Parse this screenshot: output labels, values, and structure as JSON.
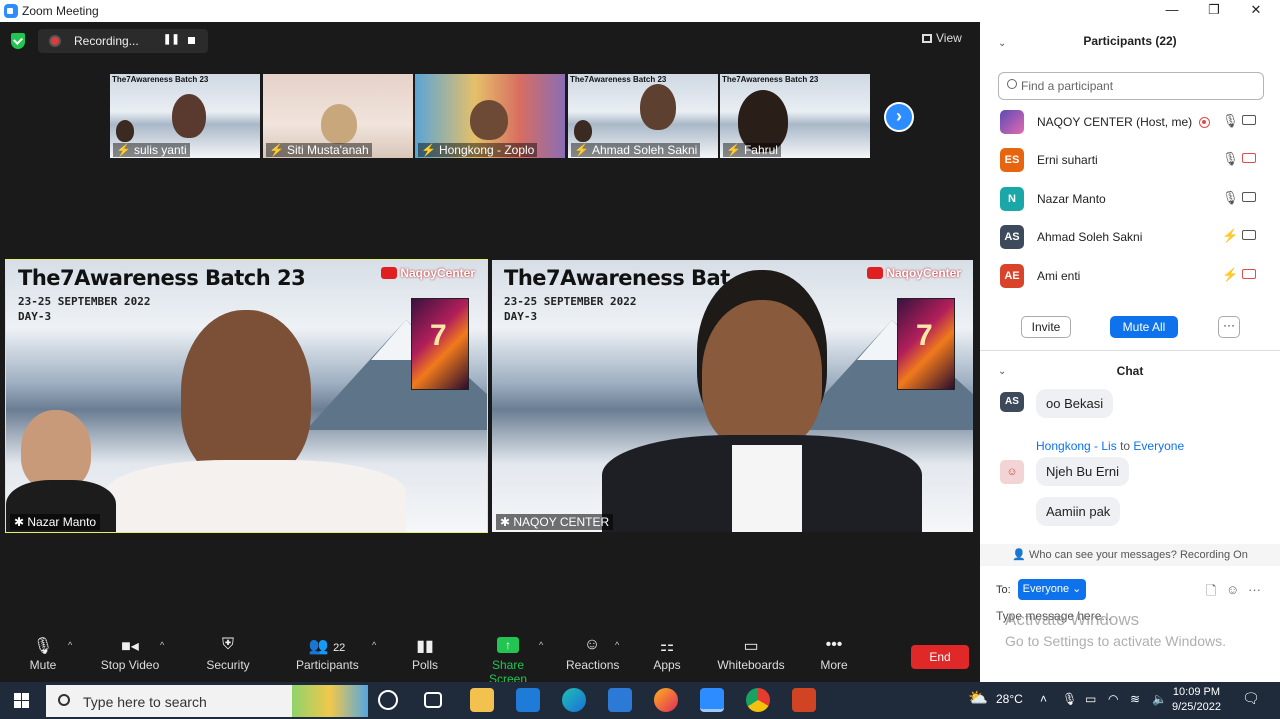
{
  "window": {
    "title": "Zoom Meeting",
    "minimize": "—",
    "restore": "❐",
    "close": "✕"
  },
  "recording": {
    "label": "Recording...",
    "pause": "❚❚"
  },
  "view_label": "View",
  "thumbnails": [
    {
      "name": "sulis yanti",
      "banner": "The7Awareness Batch 23"
    },
    {
      "name": "Siti Musta'anah"
    },
    {
      "name": "Hongkong - Zoplo"
    },
    {
      "name": "Ahmad Soleh Sakni",
      "banner": "The7Awareness Batch 23"
    },
    {
      "name": "Fahrul",
      "banner": "The7Awareness Batch 23"
    }
  ],
  "next_arrow": "›",
  "tiles": [
    {
      "title": "The7Awareness Batch 23",
      "subtitle1": "23-25 SEPTEMBER 2022",
      "subtitle2": "DAY-3",
      "brand": "NaqoyCenter",
      "name": "Nazar Manto"
    },
    {
      "title": "The7Awareness Bat",
      "subtitle1": "23-25 SEPTEMBER 2022",
      "subtitle2": "DAY-3",
      "brand": "NaqoyCenter",
      "name": "NAQOY CENTER"
    }
  ],
  "toolbar": {
    "mute": "Mute",
    "stop_video": "Stop Video",
    "security": "Security",
    "participants": "Participants",
    "participants_count": "22",
    "polls": "Polls",
    "share_screen": "Share Screen",
    "reactions": "Reactions",
    "apps": "Apps",
    "whiteboards": "Whiteboards",
    "more": "More",
    "end": "End"
  },
  "participants_panel": {
    "title": "Participants (22)",
    "search_placeholder": "Find a participant",
    "rows": [
      {
        "initials": "",
        "name": "NAQOY CENTER (Host, me)",
        "color": "#6a5acd",
        "mic_muted": false,
        "cam_muted": false
      },
      {
        "initials": "ES",
        "name": "Erni suharti",
        "color": "#e8650f",
        "mic_muted": false,
        "cam_muted": true
      },
      {
        "initials": "N",
        "name": "Nazar Manto",
        "color": "#1aa7a7",
        "mic_muted": false,
        "cam_muted": false
      },
      {
        "initials": "AS",
        "name": "Ahmad Soleh Sakni",
        "color": "#3d4a5c",
        "mic_muted": true,
        "cam_muted": false
      },
      {
        "initials": "AE",
        "name": "Ami enti",
        "color": "#d9432a",
        "mic_muted": true,
        "cam_muted": true
      }
    ],
    "invite": "Invite",
    "mute_all": "Mute All",
    "more": "···"
  },
  "chat": {
    "title": "Chat",
    "messages": [
      {
        "avatar": "AS",
        "text": "oo Bekasi"
      },
      {
        "sender": "Hongkong - Lis",
        "to_word": "to",
        "to": "Everyone",
        "text": "Njeh Bu Erni"
      },
      {
        "text": "Aamiin pak"
      }
    ],
    "who_can_see": "Who can see your messages? Recording On",
    "to_label": "To:",
    "recipient": "Everyone ⌄",
    "type_placeholder": "Type message here..."
  },
  "watermark": {
    "line1": "Activate Windows",
    "line2": "Go to Settings to activate Windows."
  },
  "taskbar": {
    "search_placeholder": "Type here to search",
    "temperature": "28°C",
    "time": "10:09 PM",
    "date": "9/25/2022"
  },
  "colors": {
    "zoom_blue": "#0e72ed",
    "end_red": "#e02828",
    "share_green": "#23c552"
  }
}
